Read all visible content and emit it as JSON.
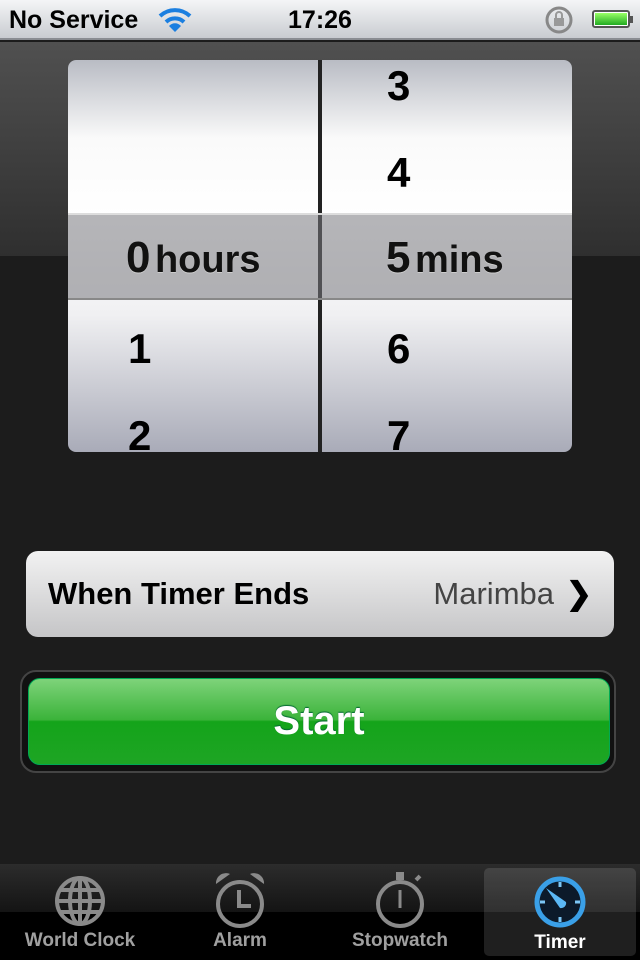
{
  "status": {
    "carrier": "No Service",
    "time": "17:26"
  },
  "picker": {
    "hours": {
      "above": [],
      "selected": "0",
      "unit": "hours",
      "below": [
        "1",
        "2"
      ]
    },
    "minutes": {
      "above": [
        "3",
        "4"
      ],
      "selected": "5",
      "unit": "mins",
      "below": [
        "6",
        "7"
      ]
    }
  },
  "sound_row": {
    "label": "When Timer Ends",
    "value": "Marimba"
  },
  "start_label": "Start",
  "tabs": [
    {
      "label": "World Clock",
      "icon": "globe-icon"
    },
    {
      "label": "Alarm",
      "icon": "alarm-clock-icon"
    },
    {
      "label": "Stopwatch",
      "icon": "stopwatch-icon"
    },
    {
      "label": "Timer",
      "icon": "timer-icon",
      "selected": true
    }
  ],
  "colors": {
    "accent": "#3aa0e8",
    "start": "#22a82a"
  }
}
